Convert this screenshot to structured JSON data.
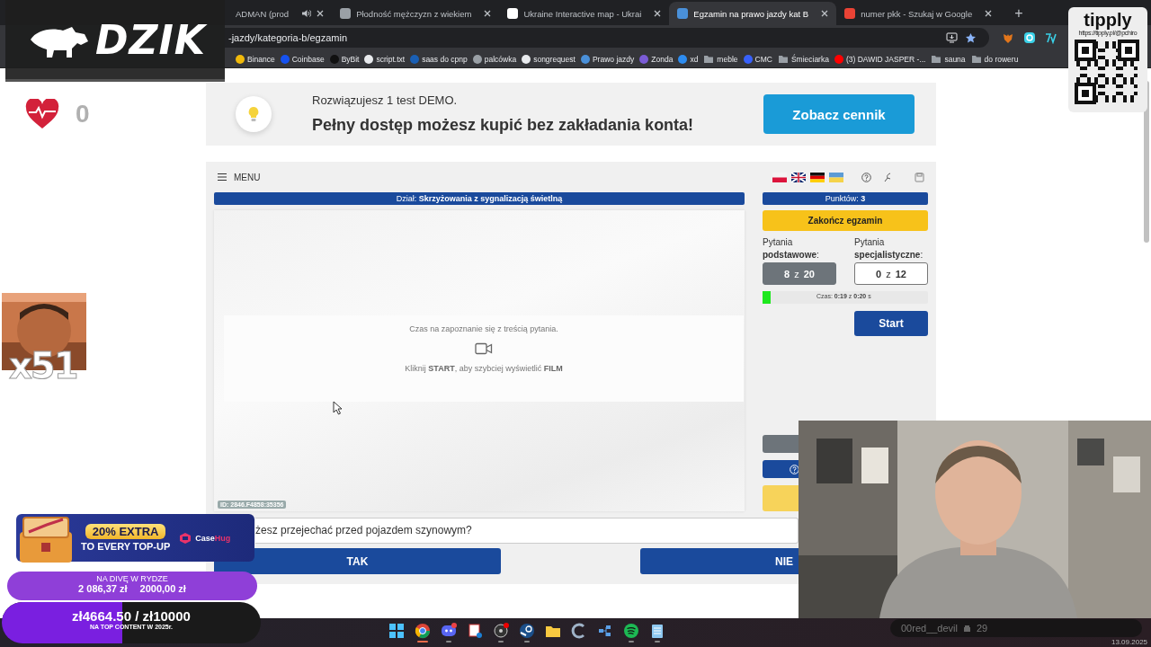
{
  "browser": {
    "tabs": [
      {
        "title": "ADMAN (prod",
        "selected": false,
        "audio": true
      },
      {
        "title": "Płodność mężczyzn z wiekiem",
        "selected": false,
        "audio": false,
        "color": "#9aa0a6"
      },
      {
        "title": "Ukraine Interactive map - Ukrai",
        "selected": false,
        "audio": false,
        "color": "#ffffff"
      },
      {
        "title": "Egzamin na prawo jazdy kat B",
        "selected": true,
        "audio": false,
        "color": "#4a90d9"
      },
      {
        "title": "numer pkk - Szukaj w Google",
        "selected": false,
        "audio": false,
        "color": "#ea4335"
      }
    ],
    "new_tab": "+",
    "address": "-jazdy/kategoria-b/egzamin",
    "bookmarks": [
      {
        "label": "Binance",
        "kind": "site",
        "color": "#f0b90b"
      },
      {
        "label": "Coinbase",
        "kind": "site",
        "color": "#1652f0"
      },
      {
        "label": "ByBit",
        "kind": "site",
        "color": "#111111"
      },
      {
        "label": "script.txt",
        "kind": "site",
        "color": "#e8eaed"
      },
      {
        "label": "saas do cpnp",
        "kind": "site",
        "color": "#1a5fb4"
      },
      {
        "label": "palcówka",
        "kind": "site",
        "color": "#9aa0a6"
      },
      {
        "label": "songrequest",
        "kind": "site",
        "color": "#e8eaed"
      },
      {
        "label": "Prawo jazdy",
        "kind": "site",
        "color": "#4a90d9"
      },
      {
        "label": "Zonda",
        "kind": "site",
        "color": "#7b5cd6"
      },
      {
        "label": "xd",
        "kind": "site",
        "color": "#2d8cf0"
      },
      {
        "label": "meble",
        "kind": "folder",
        "color": "#9aa0a6"
      },
      {
        "label": "CMC",
        "kind": "site",
        "color": "#3861fb"
      },
      {
        "label": "Śmieciarka",
        "kind": "folder",
        "color": "#9aa0a6"
      },
      {
        "label": "(3) DAWID JASPER -...",
        "kind": "site",
        "color": "#ff0000"
      },
      {
        "label": "sauna",
        "kind": "folder",
        "color": "#9aa0a6"
      },
      {
        "label": "do roweru",
        "kind": "folder",
        "color": "#9aa0a6"
      }
    ]
  },
  "banner": {
    "line1": "Rozwiązujesz 1 test DEMO.",
    "line2": "Pełny dostęp możesz kupić bez zakładania konta!",
    "button": "Zobacz cennik"
  },
  "exam": {
    "menu": "MENU",
    "section": "Dział: **Skrzyżowania z sygnalizacją świetlną**",
    "notice": "Czas na zapoznanie się z treścią pytania.",
    "hint": "Kliknij **START**, aby szybciej wyświetlić **FILM**",
    "media_id": "ID: 2846.F4858:35356",
    "question": "żesz przejechać przed pojazdem szynowym?",
    "answers": [
      "TAK",
      "NIE"
    ],
    "points": "Punktów: **3**",
    "finish": "Zakończ egzamin",
    "counters": [
      {
        "label": "Pytania **podstawowe**:",
        "value": "**8** z **20**",
        "selected": true
      },
      {
        "label": "Pytania **specjalistyczne**:",
        "value": "**0** z **12**",
        "selected": false
      }
    ],
    "timer": {
      "level": 0.05,
      "text": "Czas: **0:19** z **0:20** s"
    },
    "start": "Start"
  },
  "overlays": {
    "logo": "DZIK",
    "hearts": "0",
    "emote_count": "x51",
    "tipply": {
      "name": "tipply",
      "url": "https://tipply.pl/@pchiro"
    },
    "promo": {
      "headline": "20% EXTRA",
      "subline": "TO EVERY TOP-UP",
      "brand": [
        "Case",
        "Hug"
      ]
    },
    "goal": {
      "title": "NA DIVĘ W RYDZE",
      "current": "2 086,37 zł",
      "target": "2000,00 zł"
    },
    "top_goal": {
      "amount": "zł4664.50 / zł10000",
      "caption": "NA TOP CONTENT W 2025r.",
      "level": 0.466
    },
    "chat": {
      "user": "00red__devil",
      "count": "29"
    },
    "date": "13.09.2025"
  },
  "taskbar": [
    {
      "kind": "start",
      "running": false,
      "active": false
    },
    {
      "kind": "browser",
      "running": true,
      "active": true
    },
    {
      "kind": "chat",
      "running": true,
      "active": false
    },
    {
      "kind": "snip",
      "running": false,
      "active": false
    },
    {
      "kind": "recorder",
      "running": true,
      "active": false
    },
    {
      "kind": "steam",
      "running": true,
      "active": false
    },
    {
      "kind": "folder",
      "running": false,
      "active": false
    },
    {
      "kind": "ccleaner",
      "running": false,
      "active": false
    },
    {
      "kind": "network",
      "running": false,
      "active": false
    },
    {
      "kind": "music",
      "running": true,
      "active": false
    },
    {
      "kind": "notepad",
      "running": true,
      "active": false
    }
  ]
}
